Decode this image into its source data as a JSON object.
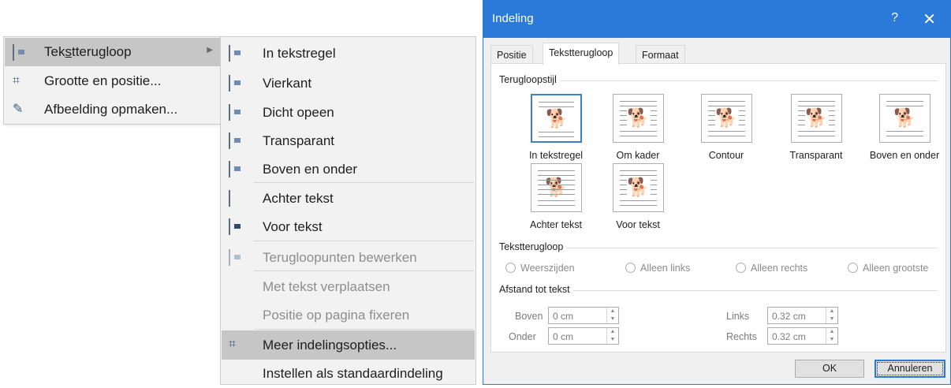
{
  "context_menu": {
    "items": [
      {
        "label": "Tekstterugloop",
        "icon": "wrap-text-icon",
        "has_submenu": true,
        "highlighted": true
      },
      {
        "label": "Grootte en positie...",
        "icon": "size-position-icon"
      },
      {
        "label": "Afbeelding opmaken...",
        "icon": "format-picture-icon"
      }
    ]
  },
  "submenu": {
    "items": [
      {
        "label": "In tekstregel",
        "icon": "inline-wrap-icon"
      },
      {
        "label": "Vierkant",
        "icon": "square-wrap-icon"
      },
      {
        "label": "Dicht opeen",
        "icon": "tight-wrap-icon"
      },
      {
        "label": "Transparant",
        "icon": "through-wrap-icon"
      },
      {
        "label": "Boven en onder",
        "icon": "top-bottom-wrap-icon"
      },
      {
        "label": "Achter tekst",
        "icon": "behind-text-icon"
      },
      {
        "label": "Voor tekst",
        "icon": "in-front-text-icon"
      },
      {
        "label": "Terugloopunten bewerken",
        "icon": "edit-wrap-points-icon",
        "disabled": true
      },
      {
        "label": "Met tekst verplaatsen",
        "disabled": true
      },
      {
        "label": "Positie op pagina fixeren",
        "disabled": true
      },
      {
        "label": "Meer indelingsopties...",
        "icon": "more-layout-icon",
        "highlighted": true
      },
      {
        "label": "Instellen als standaardindeling"
      }
    ]
  },
  "dialog": {
    "title": "Indeling",
    "help": "?",
    "close": "✕",
    "tabs": [
      "Positie",
      "Tekstterugloop",
      "Formaat"
    ],
    "active_tab": "Tekstterugloop",
    "wrap_style_group": "Terugloopstijl",
    "wrap_options": [
      {
        "label": "In tekstregel",
        "selected": true
      },
      {
        "label": "Om kader"
      },
      {
        "label": "Contour"
      },
      {
        "label": "Transparant"
      },
      {
        "label": "Boven en onder"
      },
      {
        "label": "Achter tekst"
      },
      {
        "label": "Voor tekst"
      }
    ],
    "text_wrap_group": "Tekstterugloop",
    "text_wrap_radios": [
      "Weerszijden",
      "Alleen links",
      "Alleen rechts",
      "Alleen grootste"
    ],
    "distance_group": "Afstand tot tekst",
    "distance": {
      "top_label": "Boven",
      "top_value": "0 cm",
      "bottom_label": "Onder",
      "bottom_value": "0 cm",
      "left_label": "Links",
      "left_value": "0.32 cm",
      "right_label": "Rechts",
      "right_value": "0.32 cm"
    },
    "ok_label": "OK",
    "cancel_label": "Annuleren"
  },
  "colors": {
    "title_bar": "#2b79d9",
    "menu_bg": "#f2f2f2",
    "highlight": "#c6c6c6"
  }
}
